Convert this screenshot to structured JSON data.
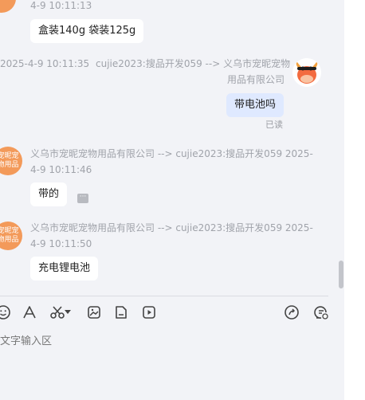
{
  "messages": [
    {
      "time_tail": "4-9 10:11:13",
      "text": "盒装140g  袋装125g"
    },
    {
      "time": "2025-4-9 10:11:35",
      "sender_line1": "cujie2023:搜品开发059 --> 义乌市宠昵宠物",
      "sender_line2": "用品有限公司",
      "text": "带电池吗",
      "status": "已读"
    },
    {
      "avatar_text": "宠昵宠物用品",
      "header_line1": "义乌市宠昵宠物用品有限公司 --> cujie2023:搜品开发059  2025-",
      "header_line2": "4-9 10:11:46",
      "text": "带的",
      "more": "···"
    },
    {
      "avatar_text": "宠昵宠物用品",
      "header_line1": "义乌市宠昵宠物用品有限公司 --> cujie2023:搜品开发059  2025-",
      "header_line2": "4-9 10:11:50",
      "text": "充电锂电池"
    }
  ],
  "toolbar": {
    "icons": [
      "emoji-icon",
      "font-icon",
      "scissors-icon",
      "image-icon",
      "file-icon",
      "video-icon"
    ],
    "right_icons": [
      "share-icon",
      "chat-history-icon"
    ]
  },
  "input": {
    "placeholder": "文字输入区"
  },
  "colors": {
    "avatar_orange": "#f39a5a",
    "my_bubble": "#dfe9ff",
    "background": "#f2f3f7"
  }
}
